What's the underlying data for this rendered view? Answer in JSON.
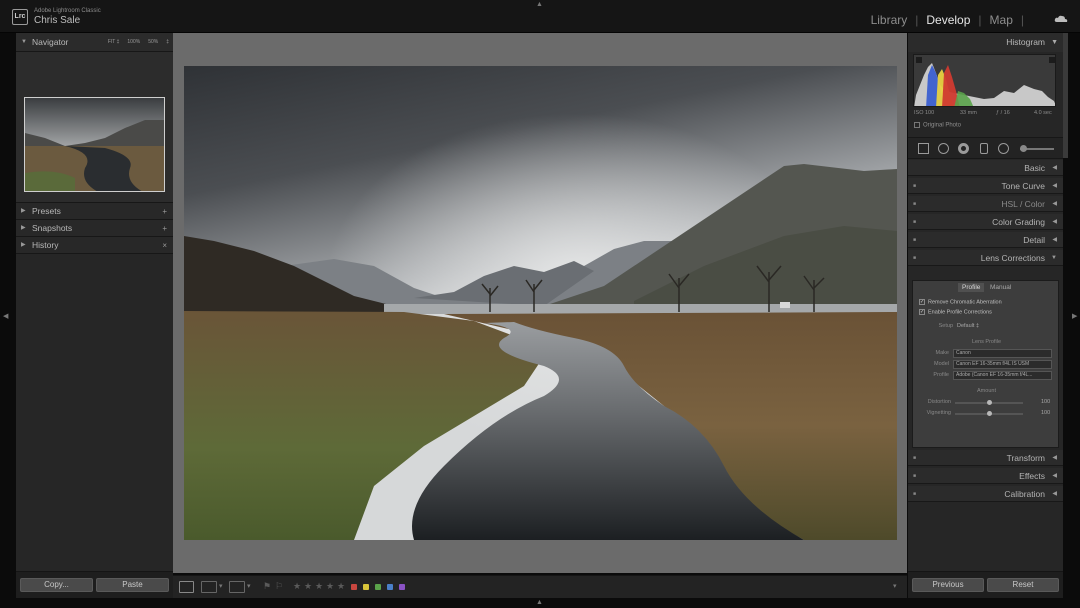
{
  "app": {
    "name": "Adobe Lightroom Classic",
    "user": "Chris Sale",
    "logo": "Lrc"
  },
  "modules": {
    "library": "Library",
    "develop": "Develop",
    "map": "Map",
    "active": "Develop"
  },
  "left_panel": {
    "navigator": {
      "title": "Navigator",
      "zoom_fit": "FIT ‡",
      "zoom_100": "100%",
      "zoom_50": "50%",
      "zoom_menu": "‡"
    },
    "sections": [
      {
        "label": "Presets",
        "action": "+"
      },
      {
        "label": "Snapshots",
        "action": "+"
      },
      {
        "label": "History",
        "action": "×"
      }
    ],
    "copy_label": "Copy...",
    "paste_label": "Paste"
  },
  "right_panel": {
    "histogram": {
      "title": "Histogram",
      "exif": {
        "iso": "ISO 100",
        "focal": "33 mm",
        "aperture": "ƒ / 16",
        "shutter": "4.0 sec"
      },
      "original_photo": "Original Photo"
    },
    "sections_top": [
      {
        "label": "Basic"
      },
      {
        "label": "Tone Curve"
      },
      {
        "label": "HSL / Color"
      },
      {
        "label": "Color Grading"
      },
      {
        "label": "Detail"
      },
      {
        "label": "Lens Corrections"
      }
    ],
    "lens_corrections": {
      "tabs": [
        "Profile",
        "Manual"
      ],
      "active_tab": "Profile",
      "remove_ca": "Remove Chromatic Aberration",
      "enable_profile": "Enable Profile Corrections",
      "setup_label": "Setup",
      "setup_value": "Default ‡",
      "lens_profile_heading": "Lens Profile",
      "make_label": "Make",
      "make_value": "Canon",
      "model_label": "Model",
      "model_value": "Canon EF 16-35mm f/4L IS USM",
      "profile_label": "Profile",
      "profile_value": "Adobe (Canon EF 16-35mm f/4L...",
      "amount_heading": "Amount",
      "distortion_label": "Distortion",
      "distortion_value": "100",
      "vignetting_label": "Vignetting",
      "vignetting_value": "100"
    },
    "sections_bottom": [
      {
        "label": "Transform"
      },
      {
        "label": "Effects"
      },
      {
        "label": "Calibration"
      }
    ],
    "previous_label": "Previous",
    "reset_label": "Reset"
  },
  "toolbar": {
    "view_modes": [
      "loupe",
      "before-after-lr",
      "before-after-yy"
    ],
    "flags": [
      "flag",
      "reject"
    ],
    "stars": [
      "★",
      "★",
      "★",
      "★",
      "★"
    ],
    "color_labels": [
      "#c8463f",
      "#d8c43a",
      "#5aa34a",
      "#4a7fc8",
      "#8a52c4"
    ]
  }
}
